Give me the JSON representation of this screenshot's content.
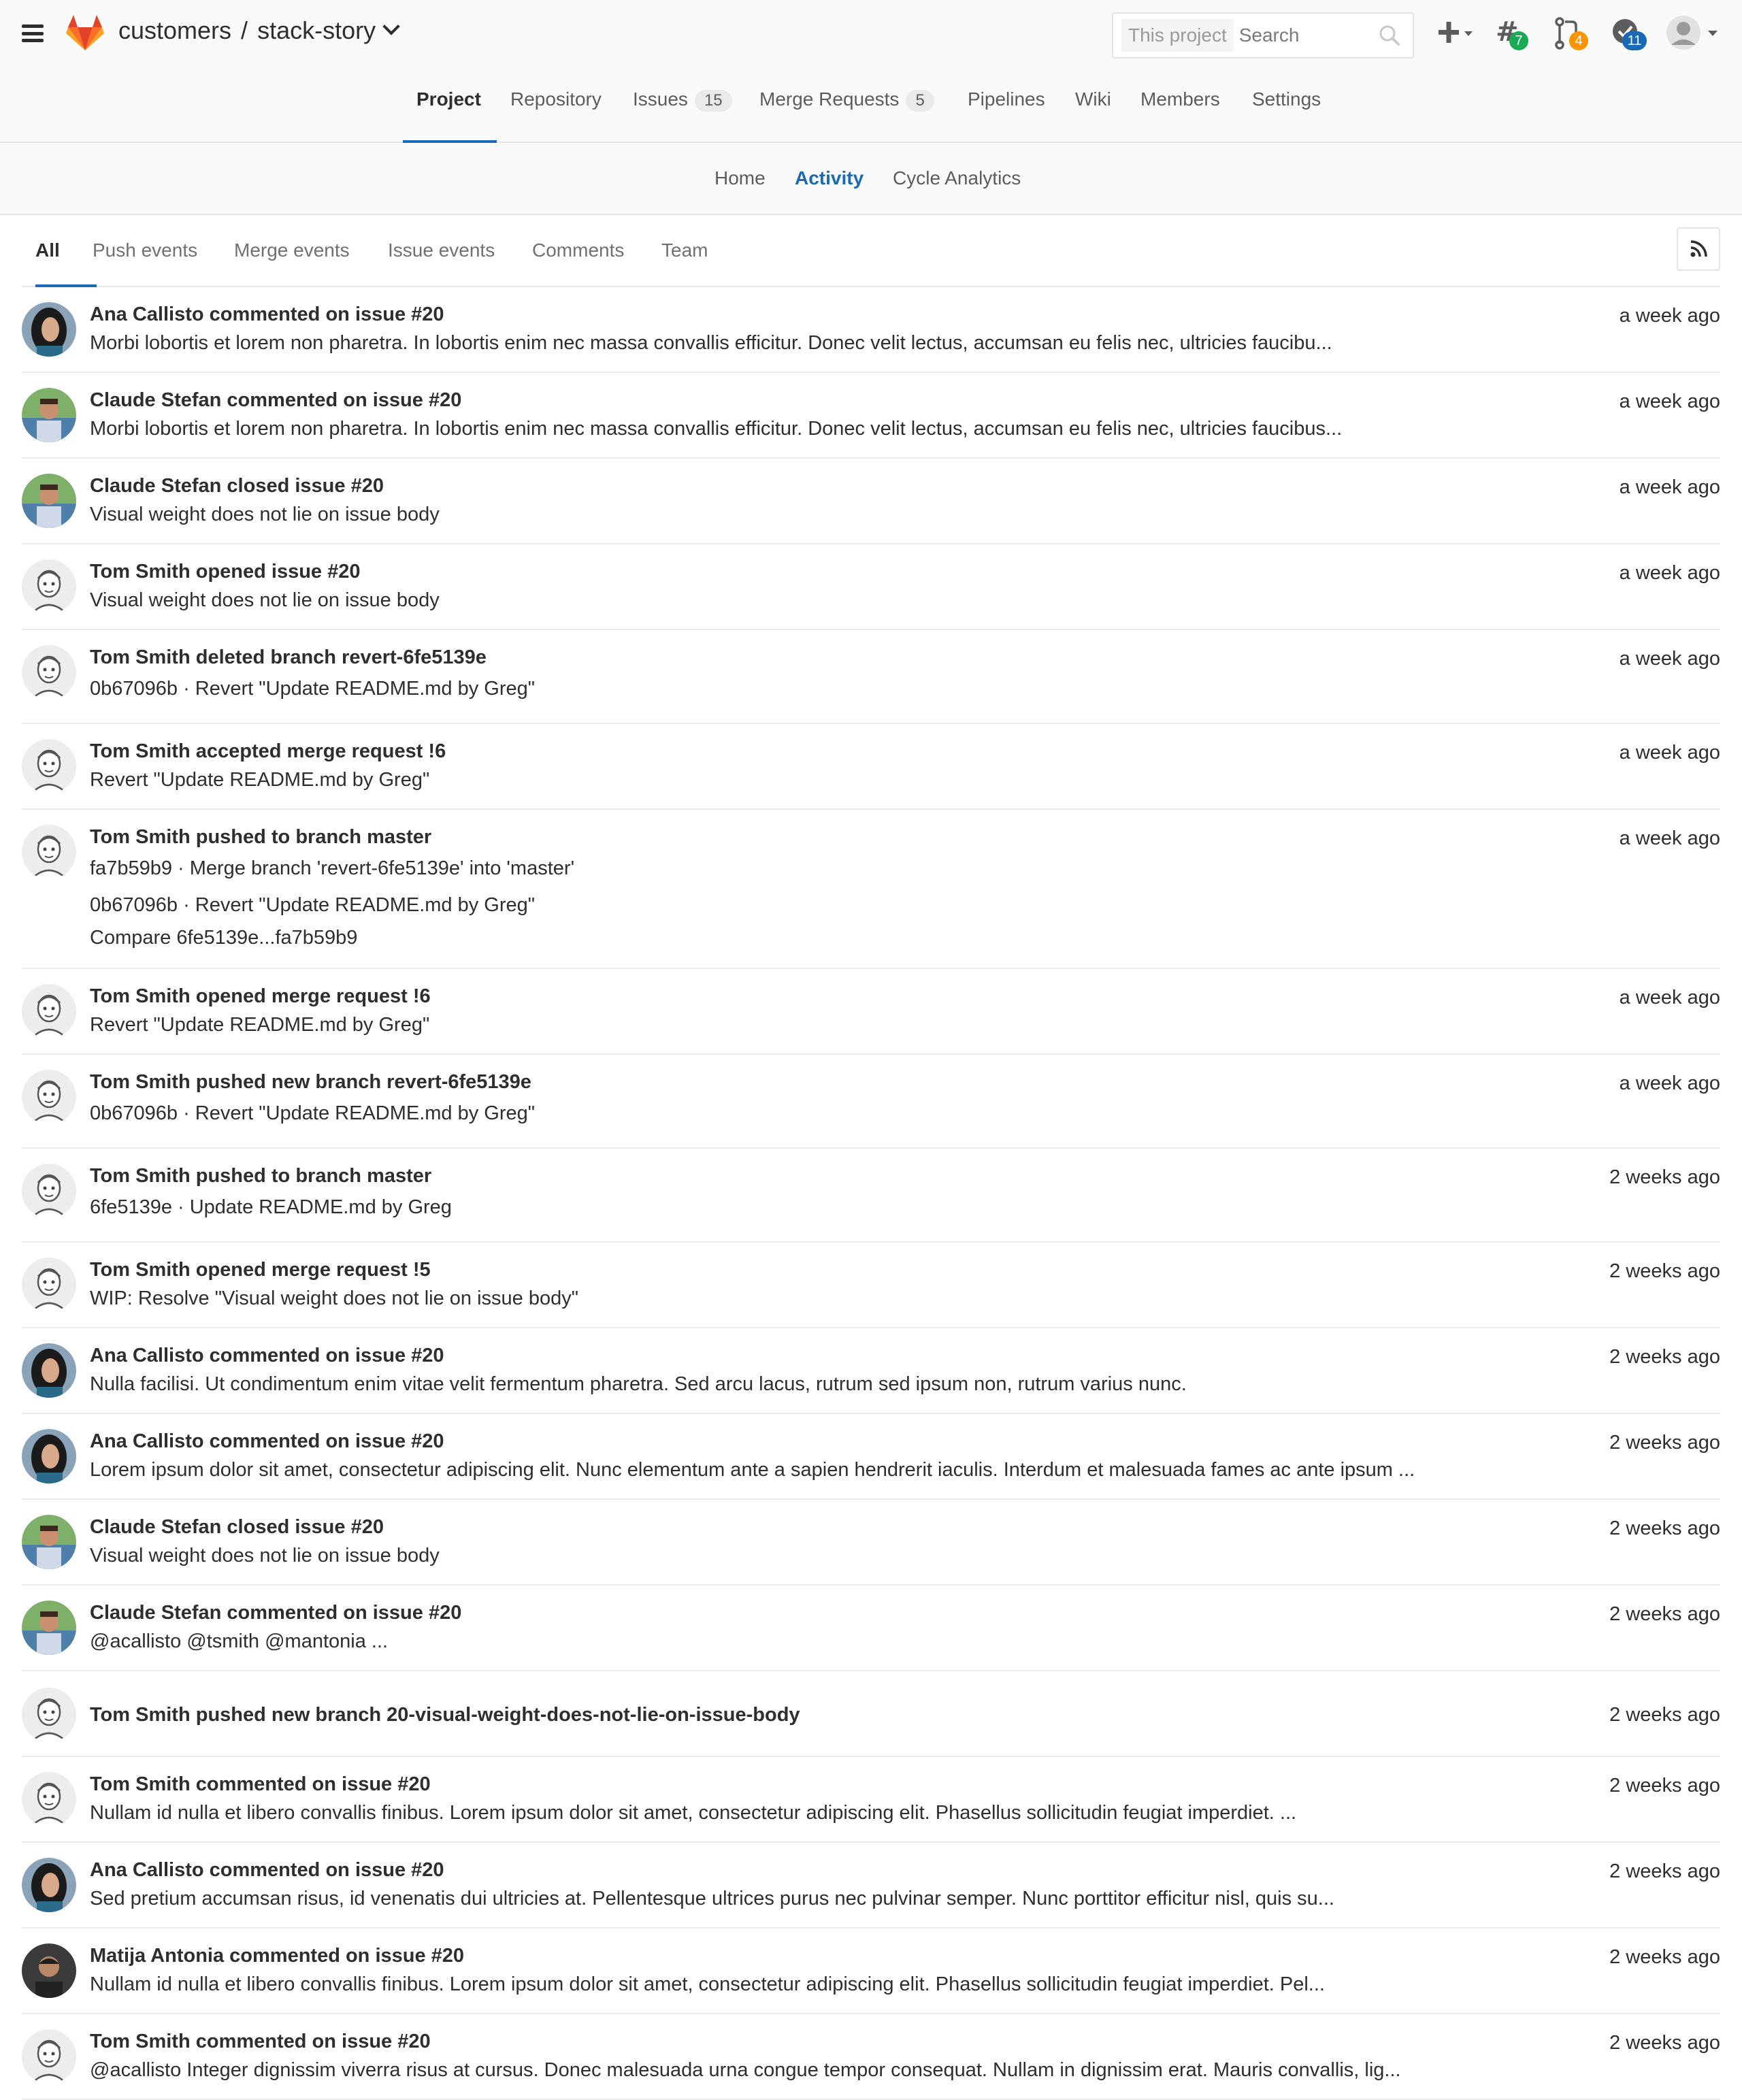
{
  "header": {
    "breadcrumb_group": "customers",
    "breadcrumb_separator": "/",
    "breadcrumb_project": "stack-story",
    "search_scope": "This project",
    "search_placeholder": "Search",
    "todos_count": "7",
    "merge_requests_count": "4",
    "issues_count": "11"
  },
  "nav": {
    "tabs": [
      {
        "label": "Project"
      },
      {
        "label": "Repository"
      },
      {
        "label": "Issues",
        "count": "15"
      },
      {
        "label": "Merge Requests",
        "count": "5"
      },
      {
        "label": "Pipelines"
      },
      {
        "label": "Wiki"
      },
      {
        "label": "Members"
      },
      {
        "label": "Settings"
      }
    ]
  },
  "subnav": {
    "items": [
      {
        "label": "Home"
      },
      {
        "label": "Activity"
      },
      {
        "label": "Cycle Analytics"
      }
    ]
  },
  "filters": {
    "items": [
      {
        "label": "All"
      },
      {
        "label": "Push events"
      },
      {
        "label": "Merge events"
      },
      {
        "label": "Issue events"
      },
      {
        "label": "Comments"
      },
      {
        "label": "Team"
      }
    ]
  },
  "events": [
    {
      "avatar": "ana",
      "title": "Ana Callisto commented on issue #20",
      "lines": [
        "Morbi lobortis et lorem non pharetra. In lobortis enim nec massa convallis efficitur. Donec velit lectus, accumsan eu felis nec, ultricies faucibu..."
      ],
      "time": "a week ago"
    },
    {
      "avatar": "claude",
      "title": "Claude Stefan commented on issue #20",
      "lines": [
        "Morbi lobortis et lorem non pharetra. In lobortis enim nec massa convallis efficitur. Donec velit lectus, accumsan eu felis nec, ultricies faucibus..."
      ],
      "time": "a week ago"
    },
    {
      "avatar": "claude",
      "title": "Claude Stefan closed issue #20",
      "lines": [
        "Visual weight does not lie on issue body"
      ],
      "time": "a week ago"
    },
    {
      "avatar": "tom",
      "title": "Tom Smith opened issue #20",
      "lines": [
        "Visual weight does not lie on issue body"
      ],
      "time": "a week ago"
    },
    {
      "avatar": "tom",
      "title": "Tom Smith deleted branch revert-6fe5139e",
      "lines": [
        "0b67096b · Revert \"Update README.md by Greg\""
      ],
      "time": "a week ago"
    },
    {
      "avatar": "tom",
      "title": "Tom Smith accepted merge request !6",
      "lines": [
        "Revert \"Update README.md by Greg\""
      ],
      "time": "a week ago"
    },
    {
      "avatar": "tom",
      "title": "Tom Smith pushed to branch master",
      "lines": [
        "fa7b59b9 · Merge branch 'revert-6fe5139e' into 'master'",
        "0b67096b · Revert \"Update README.md by Greg\"",
        "Compare 6fe5139e...fa7b59b9"
      ],
      "time": "a week ago"
    },
    {
      "avatar": "tom",
      "title": "Tom Smith opened merge request !6",
      "lines": [
        "Revert \"Update README.md by Greg\""
      ],
      "time": "a week ago"
    },
    {
      "avatar": "tom",
      "title": "Tom Smith pushed new branch revert-6fe5139e",
      "lines": [
        "0b67096b · Revert \"Update README.md by Greg\""
      ],
      "time": "a week ago"
    },
    {
      "avatar": "tom",
      "title": "Tom Smith pushed to branch master",
      "lines": [
        "6fe5139e · Update README.md by Greg"
      ],
      "time": "2 weeks ago"
    },
    {
      "avatar": "tom",
      "title": "Tom Smith opened merge request !5",
      "lines": [
        "WIP: Resolve \"Visual weight does not lie on issue body\""
      ],
      "time": "2 weeks ago"
    },
    {
      "avatar": "ana",
      "title": "Ana Callisto commented on issue #20",
      "lines": [
        "Nulla facilisi. Ut condimentum enim vitae velit fermentum pharetra. Sed arcu lacus, rutrum sed ipsum non, rutrum varius nunc."
      ],
      "time": "2 weeks ago"
    },
    {
      "avatar": "ana",
      "title": "Ana Callisto commented on issue #20",
      "lines": [
        "Lorem ipsum dolor sit amet, consectetur adipiscing elit. Nunc elementum ante a sapien hendrerit iaculis. Interdum et malesuada fames ac ante ipsum ..."
      ],
      "time": "2 weeks ago"
    },
    {
      "avatar": "claude",
      "title": "Claude Stefan closed issue #20",
      "lines": [
        "Visual weight does not lie on issue body"
      ],
      "time": "2 weeks ago"
    },
    {
      "avatar": "claude",
      "title": "Claude Stefan commented on issue #20",
      "lines": [
        "@acallisto @tsmith @mantonia ..."
      ],
      "time": "2 weeks ago"
    },
    {
      "avatar": "tom",
      "title": "Tom Smith pushed new branch 20-visual-weight-does-not-lie-on-issue-body",
      "lines": [],
      "time": "2 weeks ago"
    },
    {
      "avatar": "tom",
      "title": "Tom Smith commented on issue #20",
      "lines": [
        "Nullam id nulla et libero convallis finibus. Lorem ipsum dolor sit amet, consectetur adipiscing elit. Phasellus sollicitudin feugiat imperdiet. ..."
      ],
      "time": "2 weeks ago"
    },
    {
      "avatar": "ana",
      "title": "Ana Callisto commented on issue #20",
      "lines": [
        "Sed pretium accumsan risus, id venenatis dui ultricies at. Pellentesque ultrices purus nec pulvinar semper. Nunc porttitor efficitur nisl, quis su..."
      ],
      "time": "2 weeks ago"
    },
    {
      "avatar": "matija",
      "title": "Matija Antonia commented on issue #20",
      "lines": [
        "Nullam id nulla et libero convallis finibus. Lorem ipsum dolor sit amet, consectetur adipiscing elit. Phasellus sollicitudin feugiat imperdiet. Pel..."
      ],
      "time": "2 weeks ago"
    },
    {
      "avatar": "tom",
      "title": "Tom Smith commented on issue #20",
      "lines": [
        "@acallisto Integer dignissim viverra risus at cursus. Donec malesuada urna congue tempor consequat. Nullam in dignissim erat. Mauris convallis, lig..."
      ],
      "time": "2 weeks ago"
    }
  ]
}
